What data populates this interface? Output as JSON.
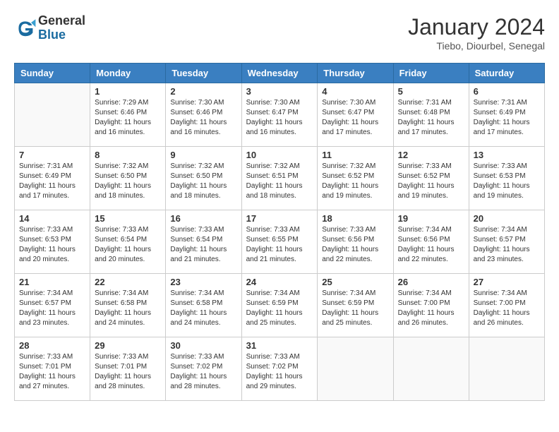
{
  "header": {
    "logo_general": "General",
    "logo_blue": "Blue",
    "title": "January 2024",
    "location": "Tiebo, Diourbel, Senegal"
  },
  "days_of_week": [
    "Sunday",
    "Monday",
    "Tuesday",
    "Wednesday",
    "Thursday",
    "Friday",
    "Saturday"
  ],
  "weeks": [
    [
      {
        "day": "",
        "sunrise": "",
        "sunset": "",
        "daylight": ""
      },
      {
        "day": "1",
        "sunrise": "Sunrise: 7:29 AM",
        "sunset": "Sunset: 6:46 PM",
        "daylight": "Daylight: 11 hours and 16 minutes."
      },
      {
        "day": "2",
        "sunrise": "Sunrise: 7:30 AM",
        "sunset": "Sunset: 6:46 PM",
        "daylight": "Daylight: 11 hours and 16 minutes."
      },
      {
        "day": "3",
        "sunrise": "Sunrise: 7:30 AM",
        "sunset": "Sunset: 6:47 PM",
        "daylight": "Daylight: 11 hours and 16 minutes."
      },
      {
        "day": "4",
        "sunrise": "Sunrise: 7:30 AM",
        "sunset": "Sunset: 6:47 PM",
        "daylight": "Daylight: 11 hours and 17 minutes."
      },
      {
        "day": "5",
        "sunrise": "Sunrise: 7:31 AM",
        "sunset": "Sunset: 6:48 PM",
        "daylight": "Daylight: 11 hours and 17 minutes."
      },
      {
        "day": "6",
        "sunrise": "Sunrise: 7:31 AM",
        "sunset": "Sunset: 6:49 PM",
        "daylight": "Daylight: 11 hours and 17 minutes."
      }
    ],
    [
      {
        "day": "7",
        "sunrise": "Sunrise: 7:31 AM",
        "sunset": "Sunset: 6:49 PM",
        "daylight": "Daylight: 11 hours and 17 minutes."
      },
      {
        "day": "8",
        "sunrise": "Sunrise: 7:32 AM",
        "sunset": "Sunset: 6:50 PM",
        "daylight": "Daylight: 11 hours and 18 minutes."
      },
      {
        "day": "9",
        "sunrise": "Sunrise: 7:32 AM",
        "sunset": "Sunset: 6:50 PM",
        "daylight": "Daylight: 11 hours and 18 minutes."
      },
      {
        "day": "10",
        "sunrise": "Sunrise: 7:32 AM",
        "sunset": "Sunset: 6:51 PM",
        "daylight": "Daylight: 11 hours and 18 minutes."
      },
      {
        "day": "11",
        "sunrise": "Sunrise: 7:32 AM",
        "sunset": "Sunset: 6:52 PM",
        "daylight": "Daylight: 11 hours and 19 minutes."
      },
      {
        "day": "12",
        "sunrise": "Sunrise: 7:33 AM",
        "sunset": "Sunset: 6:52 PM",
        "daylight": "Daylight: 11 hours and 19 minutes."
      },
      {
        "day": "13",
        "sunrise": "Sunrise: 7:33 AM",
        "sunset": "Sunset: 6:53 PM",
        "daylight": "Daylight: 11 hours and 19 minutes."
      }
    ],
    [
      {
        "day": "14",
        "sunrise": "Sunrise: 7:33 AM",
        "sunset": "Sunset: 6:53 PM",
        "daylight": "Daylight: 11 hours and 20 minutes."
      },
      {
        "day": "15",
        "sunrise": "Sunrise: 7:33 AM",
        "sunset": "Sunset: 6:54 PM",
        "daylight": "Daylight: 11 hours and 20 minutes."
      },
      {
        "day": "16",
        "sunrise": "Sunrise: 7:33 AM",
        "sunset": "Sunset: 6:54 PM",
        "daylight": "Daylight: 11 hours and 21 minutes."
      },
      {
        "day": "17",
        "sunrise": "Sunrise: 7:33 AM",
        "sunset": "Sunset: 6:55 PM",
        "daylight": "Daylight: 11 hours and 21 minutes."
      },
      {
        "day": "18",
        "sunrise": "Sunrise: 7:33 AM",
        "sunset": "Sunset: 6:56 PM",
        "daylight": "Daylight: 11 hours and 22 minutes."
      },
      {
        "day": "19",
        "sunrise": "Sunrise: 7:34 AM",
        "sunset": "Sunset: 6:56 PM",
        "daylight": "Daylight: 11 hours and 22 minutes."
      },
      {
        "day": "20",
        "sunrise": "Sunrise: 7:34 AM",
        "sunset": "Sunset: 6:57 PM",
        "daylight": "Daylight: 11 hours and 23 minutes."
      }
    ],
    [
      {
        "day": "21",
        "sunrise": "Sunrise: 7:34 AM",
        "sunset": "Sunset: 6:57 PM",
        "daylight": "Daylight: 11 hours and 23 minutes."
      },
      {
        "day": "22",
        "sunrise": "Sunrise: 7:34 AM",
        "sunset": "Sunset: 6:58 PM",
        "daylight": "Daylight: 11 hours and 24 minutes."
      },
      {
        "day": "23",
        "sunrise": "Sunrise: 7:34 AM",
        "sunset": "Sunset: 6:58 PM",
        "daylight": "Daylight: 11 hours and 24 minutes."
      },
      {
        "day": "24",
        "sunrise": "Sunrise: 7:34 AM",
        "sunset": "Sunset: 6:59 PM",
        "daylight": "Daylight: 11 hours and 25 minutes."
      },
      {
        "day": "25",
        "sunrise": "Sunrise: 7:34 AM",
        "sunset": "Sunset: 6:59 PM",
        "daylight": "Daylight: 11 hours and 25 minutes."
      },
      {
        "day": "26",
        "sunrise": "Sunrise: 7:34 AM",
        "sunset": "Sunset: 7:00 PM",
        "daylight": "Daylight: 11 hours and 26 minutes."
      },
      {
        "day": "27",
        "sunrise": "Sunrise: 7:34 AM",
        "sunset": "Sunset: 7:00 PM",
        "daylight": "Daylight: 11 hours and 26 minutes."
      }
    ],
    [
      {
        "day": "28",
        "sunrise": "Sunrise: 7:33 AM",
        "sunset": "Sunset: 7:01 PM",
        "daylight": "Daylight: 11 hours and 27 minutes."
      },
      {
        "day": "29",
        "sunrise": "Sunrise: 7:33 AM",
        "sunset": "Sunset: 7:01 PM",
        "daylight": "Daylight: 11 hours and 28 minutes."
      },
      {
        "day": "30",
        "sunrise": "Sunrise: 7:33 AM",
        "sunset": "Sunset: 7:02 PM",
        "daylight": "Daylight: 11 hours and 28 minutes."
      },
      {
        "day": "31",
        "sunrise": "Sunrise: 7:33 AM",
        "sunset": "Sunset: 7:02 PM",
        "daylight": "Daylight: 11 hours and 29 minutes."
      },
      {
        "day": "",
        "sunrise": "",
        "sunset": "",
        "daylight": ""
      },
      {
        "day": "",
        "sunrise": "",
        "sunset": "",
        "daylight": ""
      },
      {
        "day": "",
        "sunrise": "",
        "sunset": "",
        "daylight": ""
      }
    ]
  ]
}
